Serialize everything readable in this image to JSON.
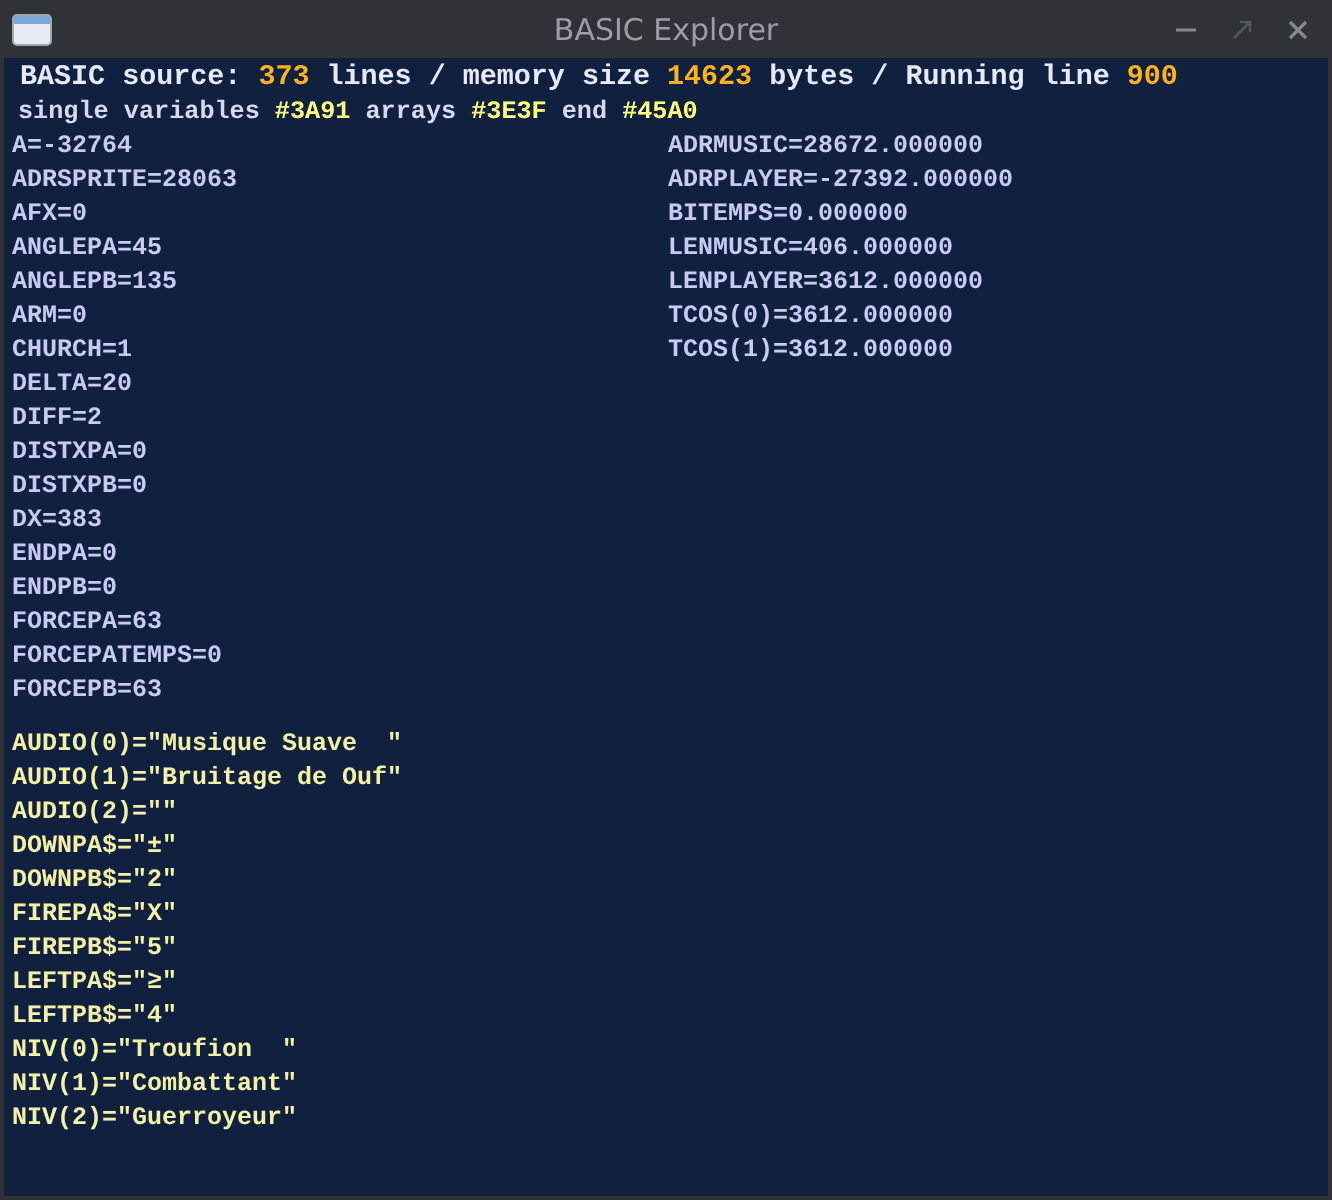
{
  "window": {
    "title": "BASIC Explorer"
  },
  "header": [
    {
      "kind": "label",
      "text": "BASIC source:"
    },
    {
      "kind": "value",
      "text": "373"
    },
    {
      "kind": "label",
      "text": "lines / memory size"
    },
    {
      "kind": "value",
      "text": "14623"
    },
    {
      "kind": "label",
      "text": "bytes / Running line"
    },
    {
      "kind": "value",
      "text": "900"
    }
  ],
  "addresses": [
    {
      "kind": "label",
      "text": "single variables"
    },
    {
      "kind": "value",
      "text": "#3A91"
    },
    {
      "kind": "label",
      "text": "arrays"
    },
    {
      "kind": "value",
      "text": "#3E3F"
    },
    {
      "kind": "label",
      "text": "end"
    },
    {
      "kind": "value",
      "text": "#45A0"
    }
  ],
  "integer_variables": [
    "A=-32764",
    "ADRSPRITE=28063",
    "AFX=0",
    "ANGLEPA=45",
    "ANGLEPB=135",
    "ARM=0",
    "CHURCH=1",
    "DELTA=20",
    "DIFF=2",
    "DISTXPA=0",
    "DISTXPB=0",
    "DX=383",
    "ENDPA=0",
    "ENDPB=0",
    "FORCEPA=63",
    "FORCEPATEMPS=0",
    "FORCEPB=63"
  ],
  "float_variables": [
    "ADRMUSIC=28672.000000",
    "ADRPLAYER=-27392.000000",
    "BITEMPS=0.000000",
    "LENMUSIC=406.000000",
    "LENPLAYER=3612.000000",
    "TCOS(0)=3612.000000",
    "TCOS(1)=3612.000000"
  ],
  "string_variables": [
    "AUDIO(0)=\"Musique Suave  \"",
    "AUDIO(1)=\"Bruitage de Ouf\"",
    "AUDIO(2)=\"\"",
    "DOWNPA$=\"±\"",
    "DOWNPB$=\"2\"",
    "FIREPA$=\"X\"",
    "FIREPB$=\"5\"",
    "LEFTPA$=\"≥\"",
    "LEFTPB$=\"4\"",
    "NIV(0)=\"Troufion  \"",
    "NIV(1)=\"Combattant\"",
    "NIV(2)=\"Guerroyeur\""
  ]
}
